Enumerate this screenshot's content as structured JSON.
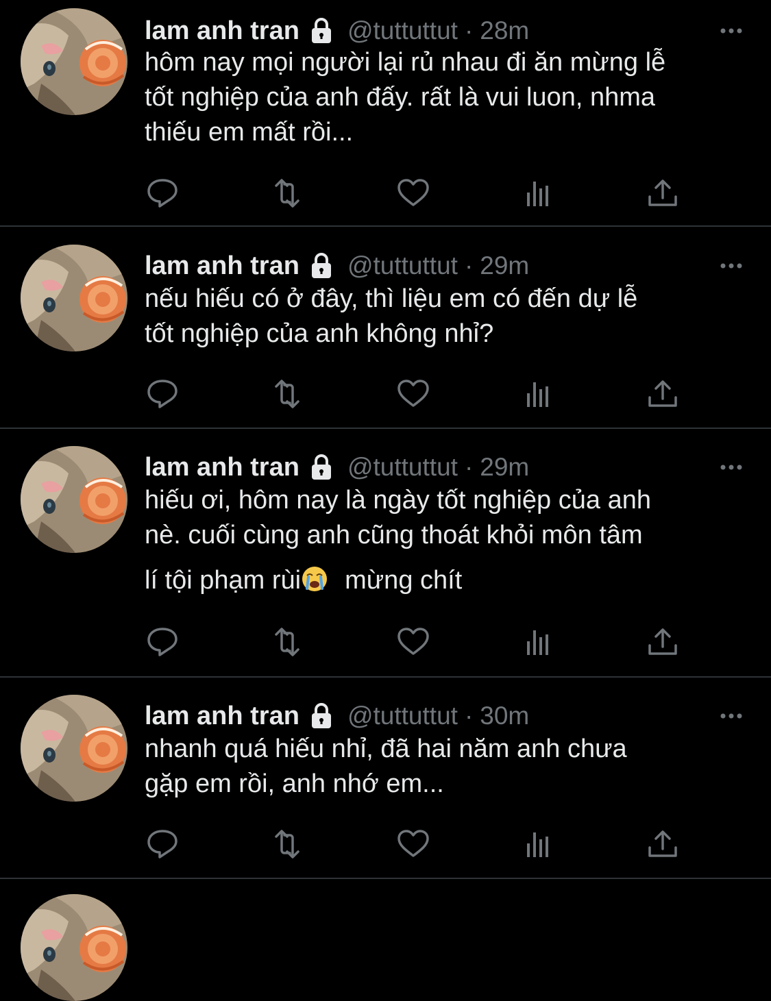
{
  "colors": {
    "background": "#000000",
    "text_primary": "#e7e9ea",
    "text_secondary": "#71767b",
    "divider": "#2f3336"
  },
  "tweets": [
    {
      "display_name": "lam anh tran",
      "handle": "@tuttuttut",
      "separator": "·",
      "time": "28m",
      "lines": [
        "hôm nay mọi người lại rủ nhau đi ăn mừng lễ",
        "tốt nghiệp của anh đấy. rất là vui luon, nhma",
        "thiếu em mất rồi..."
      ]
    },
    {
      "display_name": "lam anh tran",
      "handle": "@tuttuttut",
      "separator": "·",
      "time": "29m",
      "lines": [
        "nếu hiếu có ở đây, thì liệu em có đến dự lễ",
        "tốt nghiệp của anh không nhỉ?"
      ]
    },
    {
      "display_name": "lam anh tran",
      "handle": "@tuttuttut",
      "separator": "·",
      "time": "29m",
      "lines": [
        "hiếu ơi, hôm nay là ngày tốt nghiệp của anh",
        "nè. cuối cùng anh cũng thoát khỏi môn tâm"
      ],
      "last_line_before_emoji": "lí tội phạm rùi",
      "emoji": "loudly-crying-face-emoji",
      "last_line_after_emoji": "mừng chít"
    },
    {
      "display_name": "lam anh tran",
      "handle": "@tuttuttut",
      "separator": "·",
      "time": "30m",
      "lines": [
        "nhanh quá hiếu nhỉ, đã hai năm anh chưa",
        "gặp em rồi, anh nhớ em..."
      ]
    }
  ],
  "icons": {
    "lock": "lock-icon",
    "more": "more-icon",
    "reply": "reply-icon",
    "retweet": "retweet-icon",
    "like": "heart-icon",
    "views": "views-icon",
    "share": "share-icon"
  }
}
